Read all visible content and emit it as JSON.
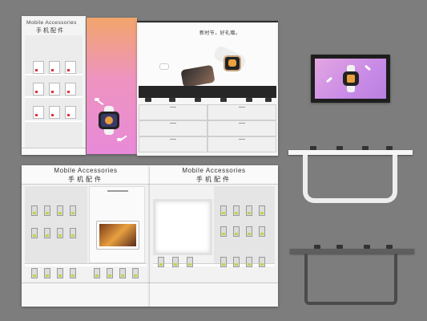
{
  "tall_cabinet": {
    "title_en": "Mobile Accessories",
    "title_cn": "手机配件"
  },
  "counter_banner": {
    "slogan": "新时节，好礼赠。"
  },
  "wall_panel_left": {
    "title_en": "Mobile Accessories",
    "title_cn": "手机配件"
  },
  "wall_panel_right": {
    "title_en": "Mobile Accessories",
    "title_cn": "手机配件"
  },
  "colors": {
    "background": "#7d7d7d",
    "banner_gradient_top": "#f2a56b",
    "banner_gradient_bottom": "#e88ad8",
    "screen_gradient": "#c98be6",
    "hook_accent": "#c4d24a",
    "box_accent": "#dd3333"
  },
  "icons": [
    "smartwatch-icon",
    "earbuds-icon",
    "display-tv-icon"
  ]
}
